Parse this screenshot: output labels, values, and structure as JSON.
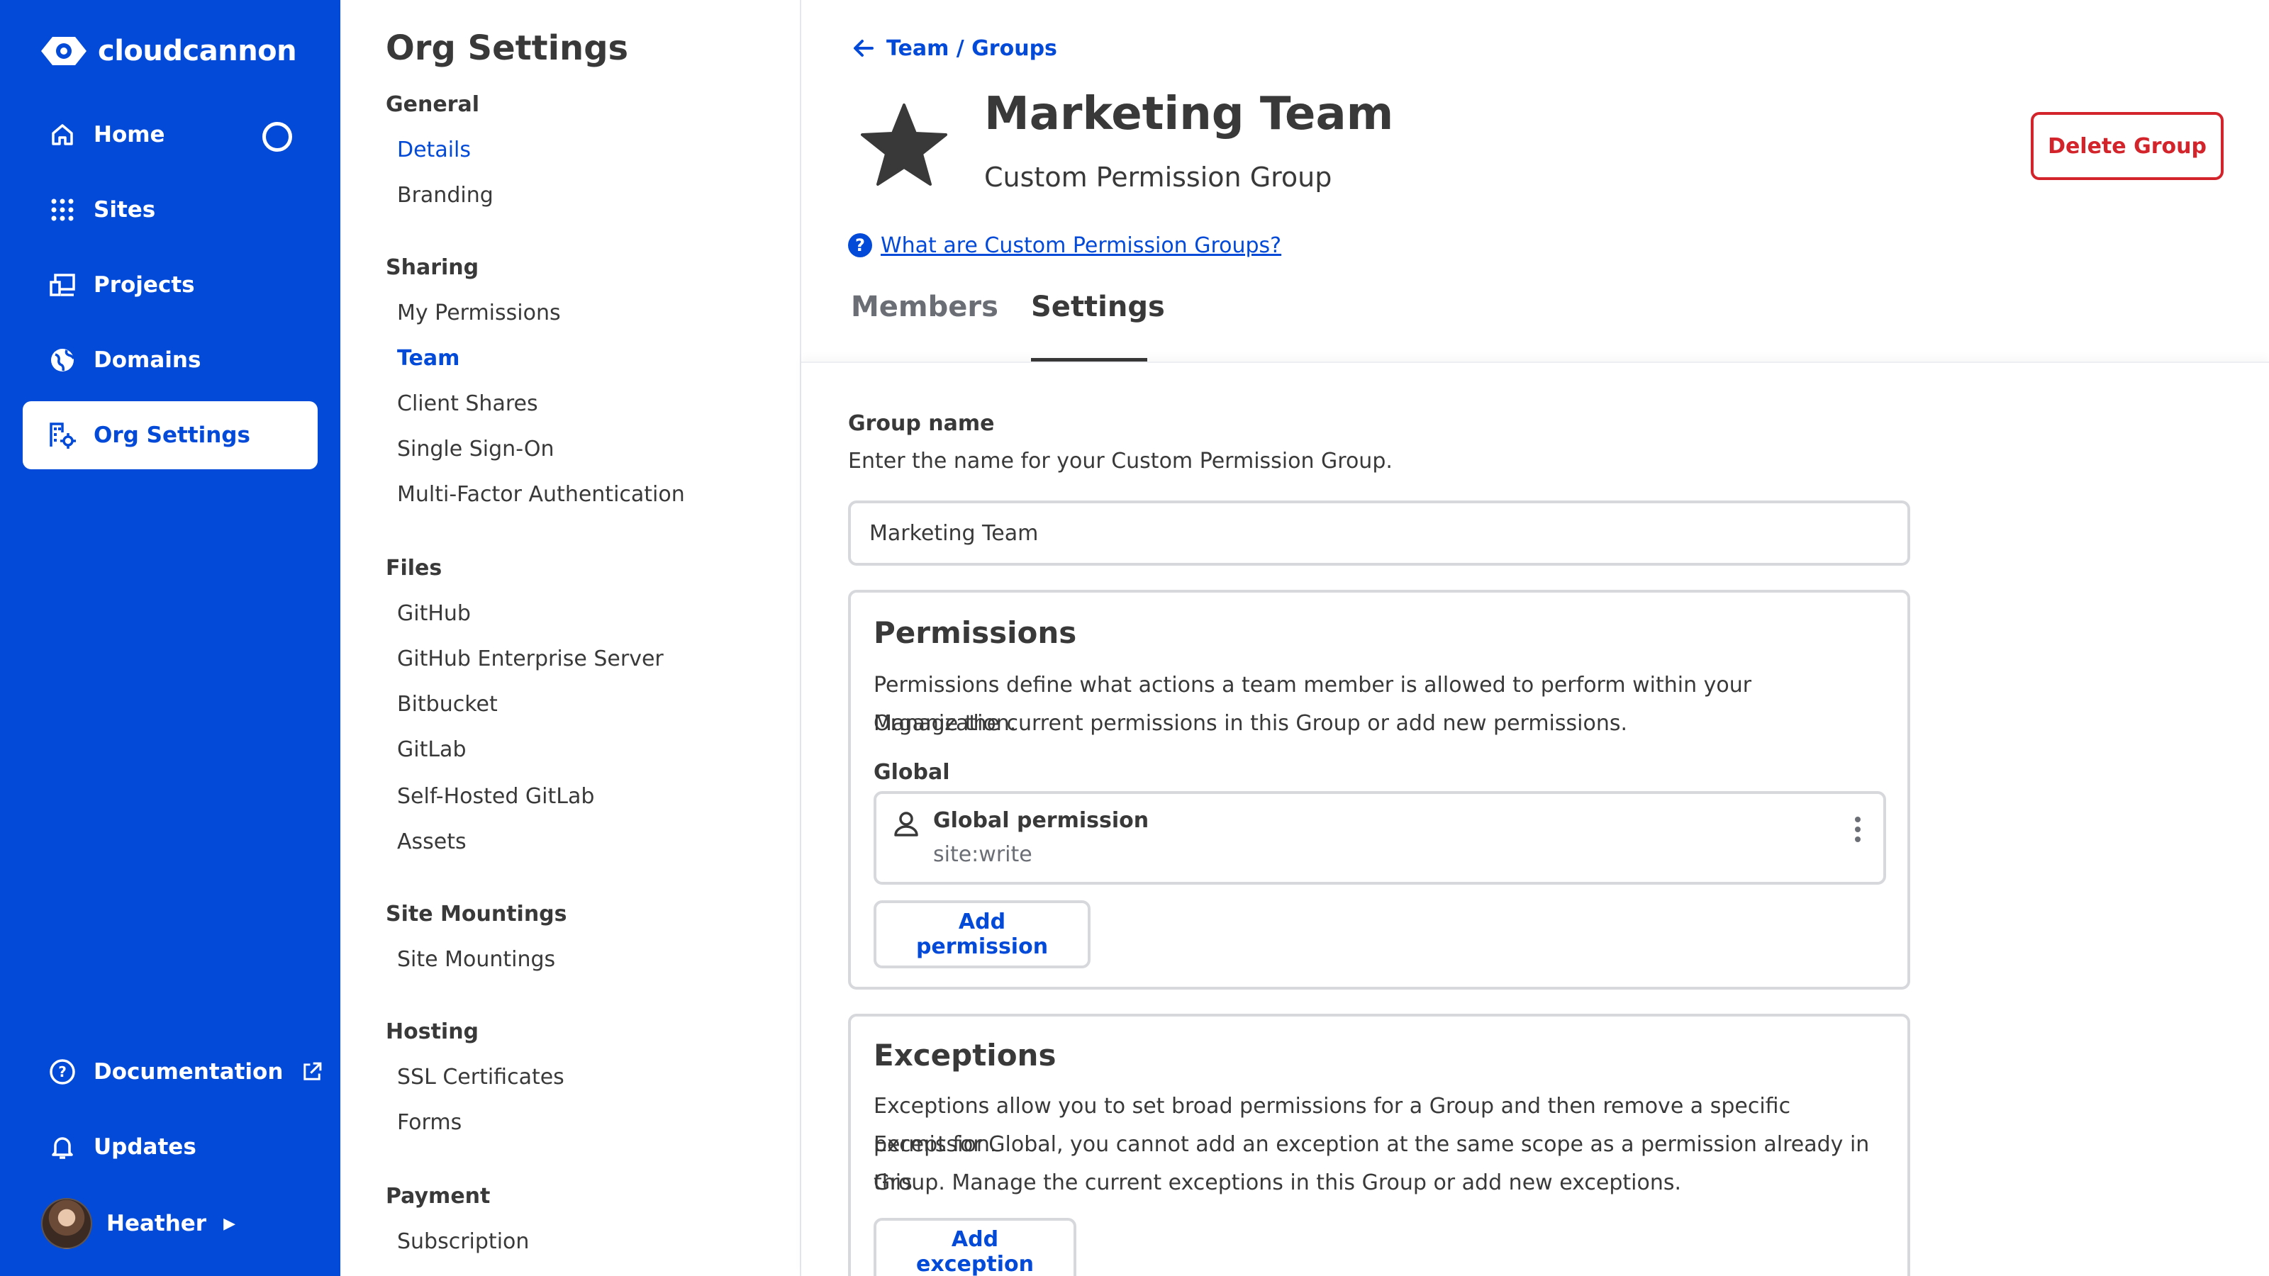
{
  "brand": {
    "name": "cloudcannon"
  },
  "primary_nav": {
    "items": [
      {
        "label": "Home",
        "icon": "home-icon"
      },
      {
        "label": "Sites",
        "icon": "grid-icon"
      },
      {
        "label": "Projects",
        "icon": "devices-icon"
      },
      {
        "label": "Domains",
        "icon": "globe-icon"
      },
      {
        "label": "Org Settings",
        "icon": "org-settings-icon",
        "active": true
      }
    ],
    "bottom_items": [
      {
        "label": "Documentation",
        "icon": "help-circle-icon"
      },
      {
        "label": "Updates",
        "icon": "bell-icon"
      }
    ],
    "user": {
      "name": "Heather"
    }
  },
  "settings_nav": {
    "title": "Org Settings",
    "sections": [
      {
        "heading": "General",
        "items": [
          "Details",
          "Branding"
        ]
      },
      {
        "heading": "Sharing",
        "items": [
          "My Permissions",
          "Team",
          "Client Shares",
          "Single Sign-On",
          "Multi-Factor Authentication"
        ]
      },
      {
        "heading": "Files",
        "items": [
          "GitHub",
          "GitHub Enterprise Server",
          "Bitbucket",
          "GitLab",
          "Self-Hosted GitLab",
          "Assets"
        ]
      },
      {
        "heading": "Site Mountings",
        "items": [
          "Site Mountings"
        ]
      },
      {
        "heading": "Hosting",
        "items": [
          "SSL Certificates",
          "Forms"
        ]
      },
      {
        "heading": "Payment",
        "items": [
          "Subscription"
        ]
      }
    ]
  },
  "main": {
    "breadcrumb": "Team / Groups",
    "title": "Marketing Team",
    "subtitle": "Custom Permission Group",
    "delete_label": "Delete Group",
    "help_link": "What are Custom Permission Groups?",
    "tabs": [
      {
        "label": "Members"
      },
      {
        "label": "Settings",
        "active": true
      }
    ],
    "group_name": {
      "label": "Group name",
      "help": "Enter the name for your Custom Permission Group.",
      "value": "Marketing Team"
    },
    "permissions": {
      "title": "Permissions",
      "description_line1": "Permissions define what actions a team member is allowed to perform within your Organization.",
      "description_line2": "Manage the current permissions in this Group or add new permissions.",
      "scope_heading": "Global",
      "item": {
        "name": "Global permission",
        "scope": "site:write"
      },
      "add_label": "Add permission"
    },
    "exceptions": {
      "title": "Exceptions",
      "description_line1": "Exceptions allow you to set broad permissions for a Group and then remove a specific permission.",
      "description_line2": "Except for Global, you cannot add an exception at the same scope as a permission already in this",
      "description_line3": "Group. Manage the current exceptions in this Group or add new exceptions.",
      "add_label": "Add exception"
    }
  },
  "colors": {
    "brand_blue": "#034ad8",
    "danger_red": "#d3242b",
    "text": "#393939",
    "border": "#d6d8dc"
  }
}
